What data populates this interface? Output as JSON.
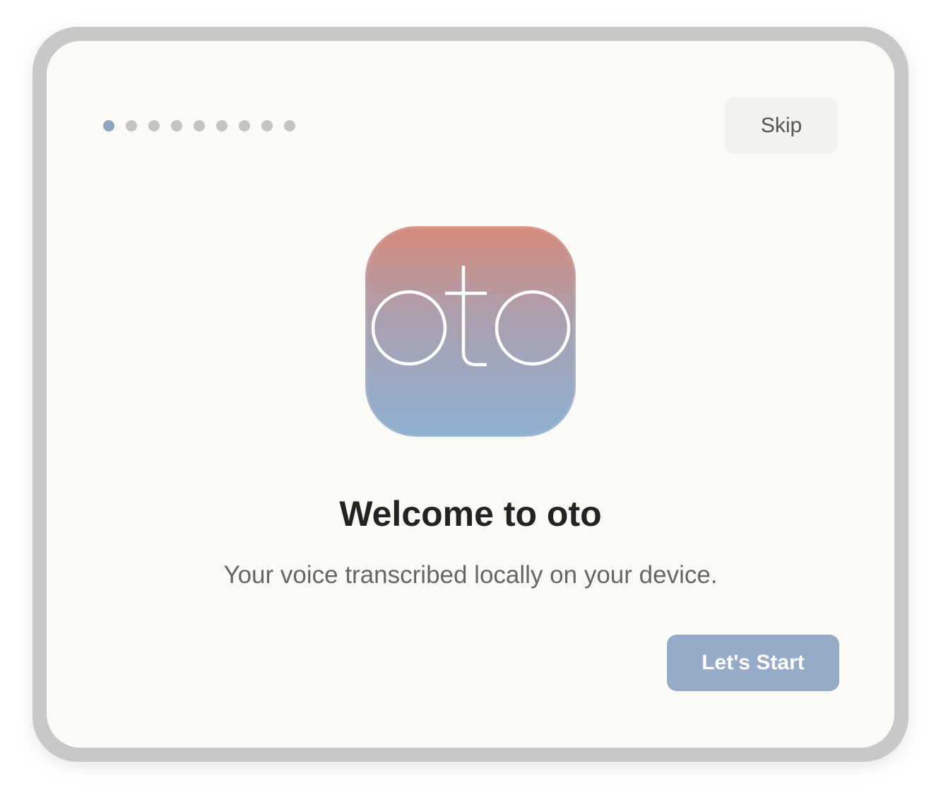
{
  "onboarding": {
    "steps_total": 9,
    "current_step": 1,
    "skip_label": "Skip",
    "logo": {
      "text": "oto",
      "name": "oto-app-icon"
    },
    "title": "Welcome to oto",
    "subtitle": "Your voice transcribed locally on your device.",
    "start_label": "Let's Start"
  },
  "colors": {
    "accent": "#95abc8",
    "active_dot": "#8ea6c4",
    "inactive_dot": "#c4c4c2",
    "logo_gradient_top": "#d68a7b",
    "logo_gradient_bottom": "#8fb0d1"
  }
}
